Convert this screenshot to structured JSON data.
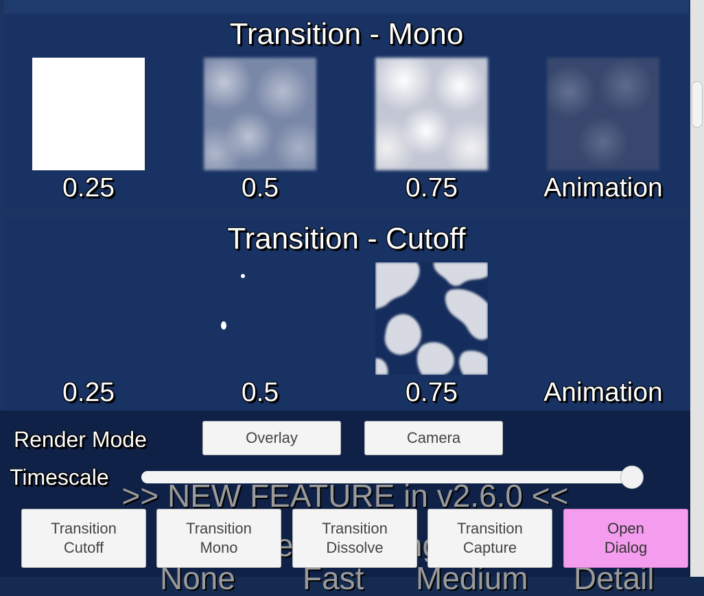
{
  "sections": {
    "mono": {
      "title": "Transition - Mono",
      "labels": [
        "0.25",
        "0.5",
        "0.75",
        "Animation"
      ]
    },
    "cutoff": {
      "title": "Transition - Cutoff",
      "labels": [
        "0.25",
        "0.5",
        "0.75",
        "Animation"
      ]
    }
  },
  "controls": {
    "render_mode_label": "Render Mode",
    "overlay_button": "Overlay",
    "camera_button": "Camera",
    "timescale_label": "Timescale",
    "timescale_value": 0.97
  },
  "feature_banner": ">> NEW FEATURE in v2.6.0 <<",
  "obscured_text": {
    "fragment_a": "e",
    "fragment_b": "ng",
    "bottom_row": [
      "None",
      "Fast",
      "Medium",
      "Detail"
    ]
  },
  "buttons": [
    {
      "line1": "Transition",
      "line2": "Cutoff"
    },
    {
      "line1": "Transition",
      "line2": "Mono"
    },
    {
      "line1": "Transition",
      "line2": "Dissolve"
    },
    {
      "line1": "Transition",
      "line2": "Capture"
    },
    {
      "line1": "Open",
      "line2": "Dialog"
    }
  ],
  "colors": {
    "panel_bg": "#152a4f",
    "section_bg": "#183264",
    "dialog_button": "#f49ced"
  },
  "scrollbar": {
    "position": 0.15
  }
}
